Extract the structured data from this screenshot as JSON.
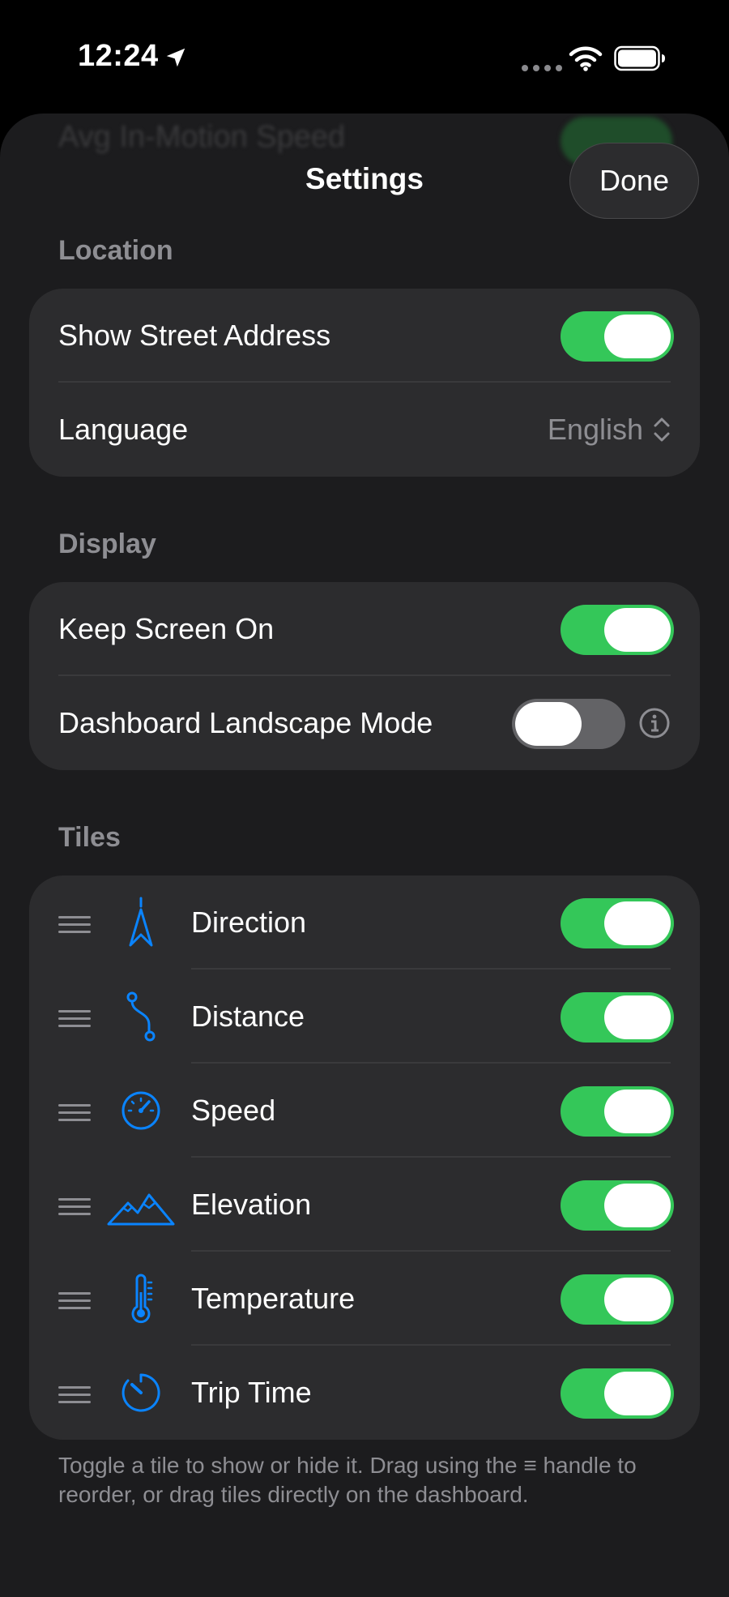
{
  "status_bar": {
    "time": "12:24"
  },
  "nav": {
    "title": "Settings",
    "done_label": "Done",
    "ghost_row_label": "Avg In-Motion Speed"
  },
  "sections": {
    "location": {
      "header": "Location",
      "show_street_address": {
        "label": "Show Street Address",
        "on": true
      },
      "language": {
        "label": "Language",
        "value": "English"
      }
    },
    "display": {
      "header": "Display",
      "keep_screen_on": {
        "label": "Keep Screen On",
        "on": true
      },
      "landscape_mode": {
        "label": "Dashboard Landscape Mode",
        "on": false
      }
    },
    "tiles": {
      "header": "Tiles",
      "items": [
        {
          "label": "Direction",
          "icon": "direction-icon",
          "on": true
        },
        {
          "label": "Distance",
          "icon": "distance-icon",
          "on": true
        },
        {
          "label": "Speed",
          "icon": "speedometer-icon",
          "on": true
        },
        {
          "label": "Elevation",
          "icon": "mountains-icon",
          "on": true
        },
        {
          "label": "Temperature",
          "icon": "thermometer-icon",
          "on": true
        },
        {
          "label": "Trip Time",
          "icon": "timer-icon",
          "on": true
        }
      ],
      "footer": "Toggle a tile to show or hide it. Drag using the ≡ handle to reorder, or drag tiles directly on the dashboard."
    }
  },
  "colors": {
    "accent_green": "#34c759",
    "icon_blue": "#0a84ff",
    "background": "#1c1c1e",
    "card": "#2c2c2e"
  }
}
